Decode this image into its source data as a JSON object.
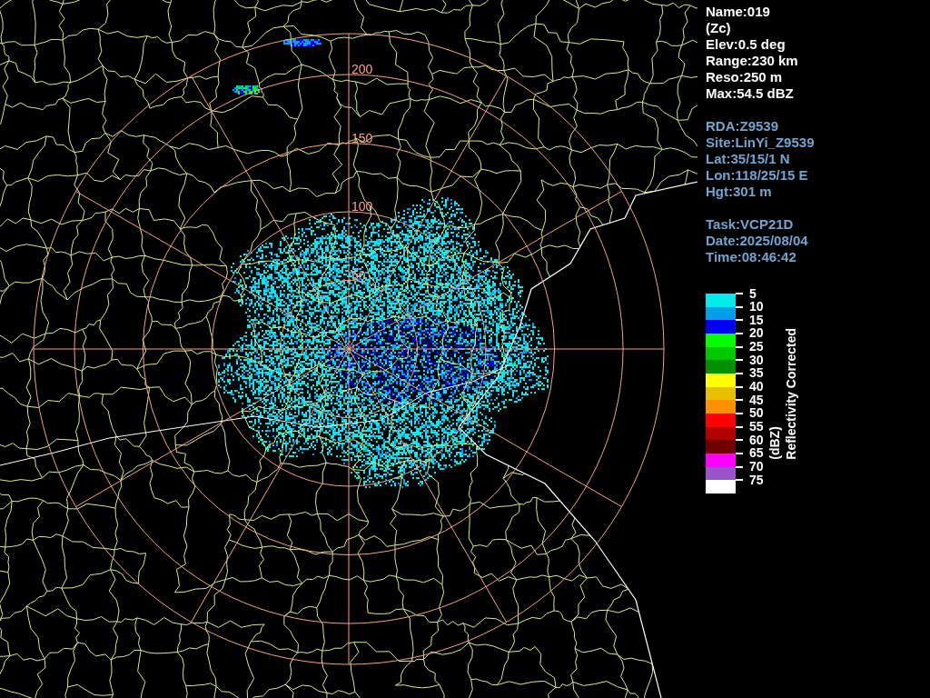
{
  "product_info": [
    "Name:019",
    "(Zc)",
    "Elev:0.5 deg",
    "Range:230 km",
    "Reso:250 m",
    "Max:54.5 dBZ"
  ],
  "site_info": [
    "RDA:Z9539",
    "Site:LinYi_Z9539",
    "Lat:35/15/1 N",
    "Lon:118/25/15 E",
    "Hgt:301 m"
  ],
  "task_info": [
    "Task:VCP21D",
    "Date:2025/08/04",
    "Time:08:46:42"
  ],
  "radar_display": {
    "range_labels": [
      "200",
      "150",
      "100",
      "50"
    ]
  },
  "legend": {
    "unit": "(dBZ)",
    "title": "Reflectivity Corrected",
    "bins": [
      {
        "label": "5",
        "color": "#00ecec"
      },
      {
        "label": "10",
        "color": "#01a0e6"
      },
      {
        "label": "15",
        "color": "#0000f0"
      },
      {
        "label": "20",
        "color": "#00ff00"
      },
      {
        "label": "25",
        "color": "#00c800"
      },
      {
        "label": "30",
        "color": "#009000"
      },
      {
        "label": "35",
        "color": "#ffff00"
      },
      {
        "label": "40",
        "color": "#e7c000"
      },
      {
        "label": "45",
        "color": "#ff9000"
      },
      {
        "label": "50",
        "color": "#ff0000"
      },
      {
        "label": "55",
        "color": "#b00000"
      },
      {
        "label": "60",
        "color": "#700000"
      },
      {
        "label": "65",
        "color": "#ff00ff"
      },
      {
        "label": "70",
        "color": "#9955c8"
      },
      {
        "label": "75",
        "color": "#ffffff"
      }
    ]
  }
}
